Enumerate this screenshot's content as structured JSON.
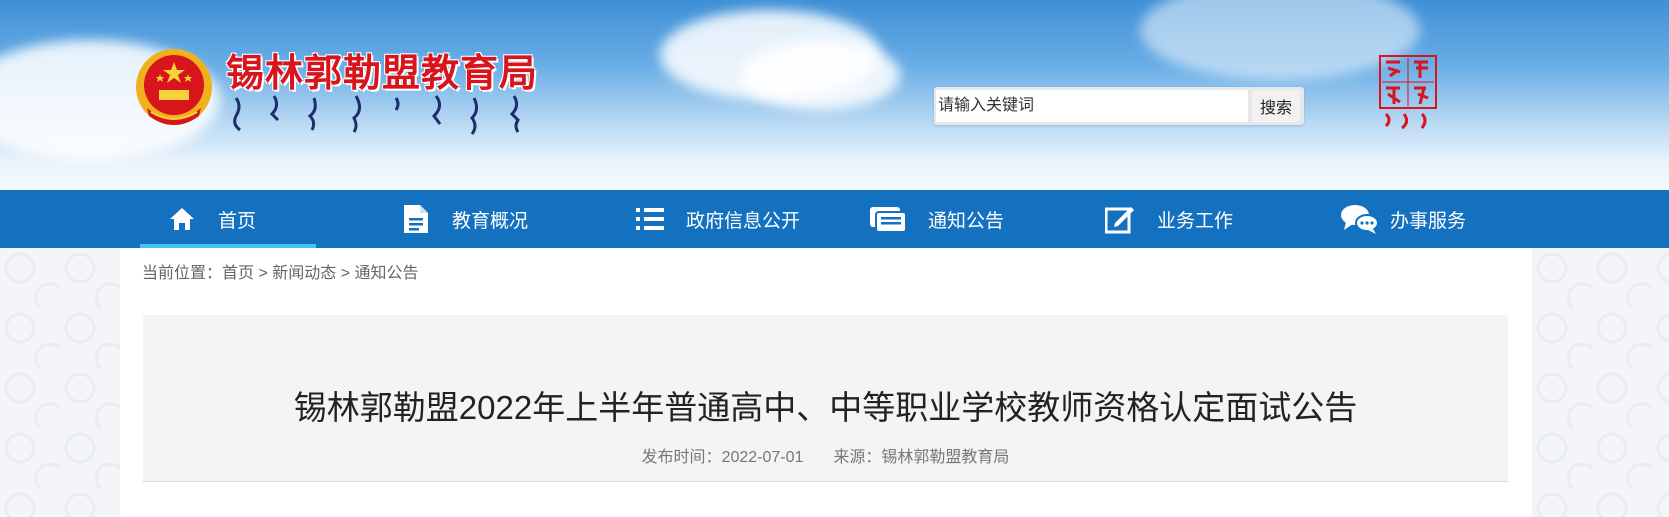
{
  "header": {
    "site_title": "锡林郭勒盟教育局",
    "search": {
      "placeholder": "请输入关键词",
      "button_label": "搜索"
    }
  },
  "nav": {
    "items": [
      {
        "label": "首页",
        "icon": "home-icon",
        "active": true
      },
      {
        "label": "教育概况",
        "icon": "document-icon"
      },
      {
        "label": "政府信息公开",
        "icon": "list-icon"
      },
      {
        "label": "通知公告",
        "icon": "notice-icon"
      },
      {
        "label": "业务工作",
        "icon": "edit-icon"
      },
      {
        "label": "办事服务",
        "icon": "chat-icon"
      }
    ]
  },
  "breadcrumb": {
    "prefix": "当前位置：",
    "items": [
      "首页",
      "新闻动态",
      "通知公告"
    ],
    "separator": " > "
  },
  "article": {
    "title": "锡林郭勒盟2022年上半年普通高中、中等职业学校教师资格认定面试公告",
    "publish_label": "发布时间：",
    "publish_date": "2022-07-01",
    "source_label": "来源：",
    "source": "锡林郭勒盟教育局"
  },
  "colors": {
    "nav_bg": "#1471c0",
    "nav_active_underline": "#41c3f5",
    "title_red": "#d8141d"
  }
}
